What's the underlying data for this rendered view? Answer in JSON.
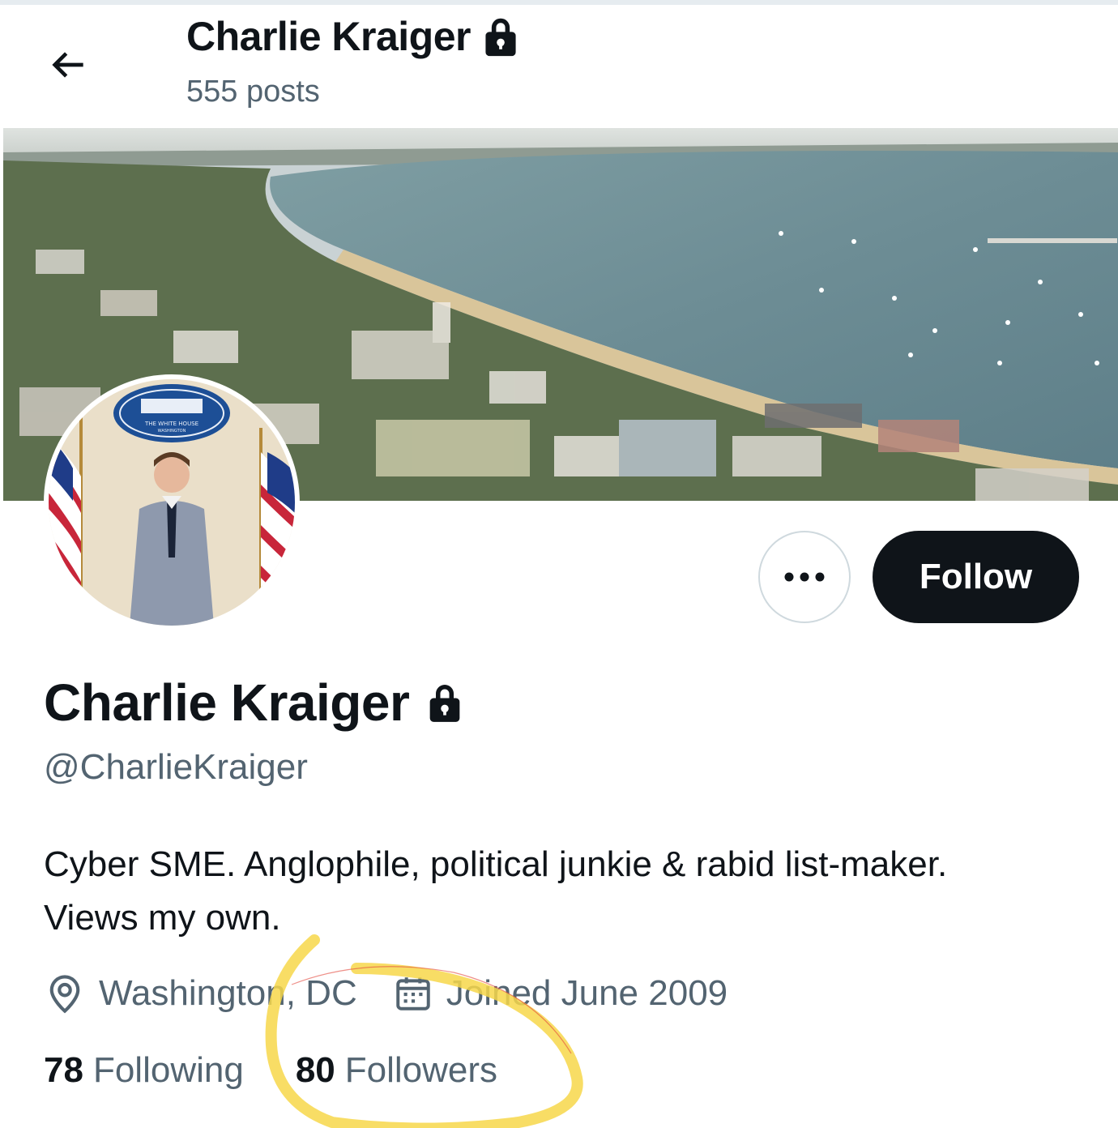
{
  "header": {
    "back_icon": "arrow-left-icon",
    "name": "Charlie Kraiger",
    "protected_icon": "lock-icon",
    "posts": "555 posts"
  },
  "banner": {
    "description_icon": "banner-image"
  },
  "avatar": {
    "seal_text": "THE WHITE HOUSE",
    "seal_subtext": "WASHINGTON"
  },
  "actions": {
    "more_icon": "more-horizontal-icon",
    "follow_label": "Follow"
  },
  "profile": {
    "display_name": "Charlie Kraiger",
    "handle": "@CharlieKraiger",
    "bio_line1": "Cyber SME. Anglophile, political junkie & rabid list-maker.",
    "bio_line2": "Views my own.",
    "location": "Washington, DC",
    "location_icon": "location-pin-icon",
    "joined": "Joined June 2009",
    "joined_icon": "calendar-icon"
  },
  "stats": {
    "following_count": "78",
    "following_label": "Following",
    "followers_count": "80",
    "followers_label": "Followers"
  },
  "colors": {
    "text_primary": "#0f1419",
    "text_secondary": "#536471",
    "follow_button_bg": "#0f1419",
    "border": "#cfd9de",
    "highlight": "#f7d74a"
  }
}
